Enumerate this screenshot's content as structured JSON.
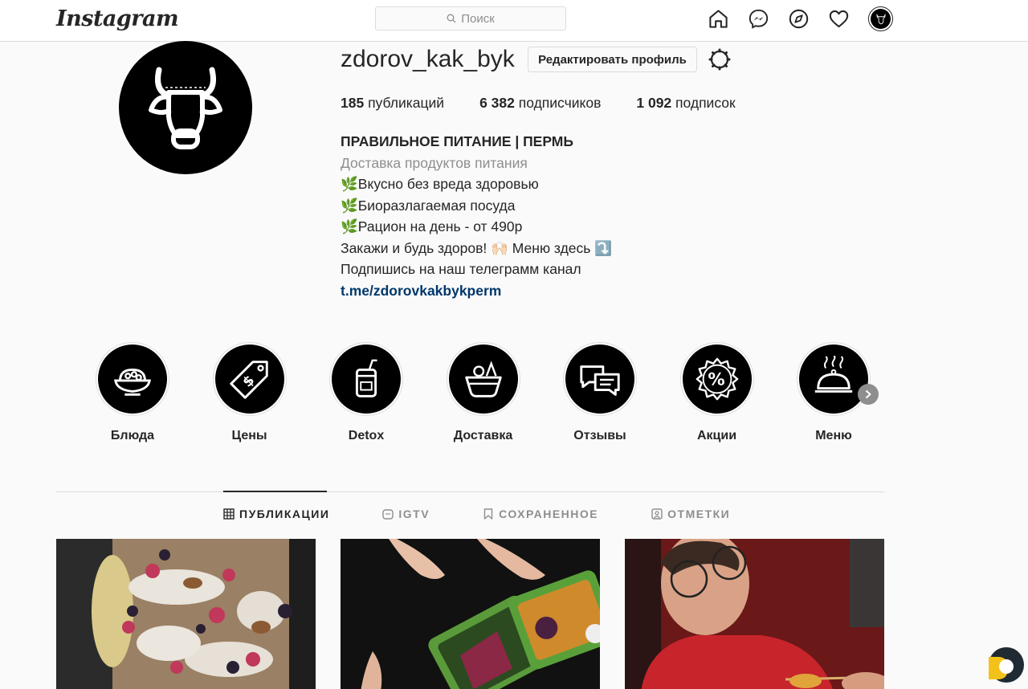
{
  "nav": {
    "logo": "Instagram",
    "search_placeholder": "Поиск",
    "icons": [
      "home-icon",
      "direct-messenger-icon",
      "explore-compass-icon",
      "activity-heart-icon",
      "profile-avatar"
    ]
  },
  "profile": {
    "username": "zdorov_kak_byk",
    "edit_button": "Редактировать профиль",
    "stats": {
      "posts_count": "185",
      "posts_label": "публикаций",
      "followers_count": "6 382",
      "followers_label": "подписчиков",
      "following_count": "1 092",
      "following_label": "подписок"
    },
    "bio": {
      "name": "ПРАВИЛЬНОЕ ПИТАНИЕ | ПЕРМЬ",
      "category": "Доставка продуктов питания",
      "line1": "🌿Вкусно без вреда здоровью",
      "line2": "🌿Биоразлагаемая посуда",
      "line3": "🌿Рацион на день - от 490р",
      "line4": "Закажи и будь здоров! 🙌🏻 Меню здесь ⤵️",
      "line5": "Подпишись на наш телеграмм канал",
      "link": "t.me/zdorovkakbykperm"
    }
  },
  "highlights": [
    {
      "label": "Блюда",
      "icon": "noodle-bowl-icon"
    },
    {
      "label": "Цены",
      "icon": "price-tag-icon"
    },
    {
      "label": "Detox",
      "icon": "juice-jar-icon"
    },
    {
      "label": "Доставка",
      "icon": "delivery-basket-icon"
    },
    {
      "label": "Отзывы",
      "icon": "chat-bubbles-icon"
    },
    {
      "label": "Акции",
      "icon": "percent-badge-icon"
    },
    {
      "label": "Меню",
      "icon": "food-cloche-icon"
    }
  ],
  "tabs": [
    {
      "label": "ПУБЛИКАЦИИ",
      "icon": "grid-icon",
      "active": true
    },
    {
      "label": "IGTV",
      "icon": "igtv-icon",
      "active": false
    },
    {
      "label": "СОХРАНЕННОЕ",
      "icon": "bookmark-icon",
      "active": false
    },
    {
      "label": "ОТМЕТКИ",
      "icon": "tagged-icon",
      "active": false
    }
  ],
  "posts": [
    {
      "description": "baked pears with berries"
    },
    {
      "description": "food containers on table"
    },
    {
      "description": "man eating with chopsticks"
    }
  ],
  "colors": {
    "link": "#00376b",
    "muted": "#8e8e8e",
    "border": "#dbdbdb",
    "text": "#262626"
  }
}
